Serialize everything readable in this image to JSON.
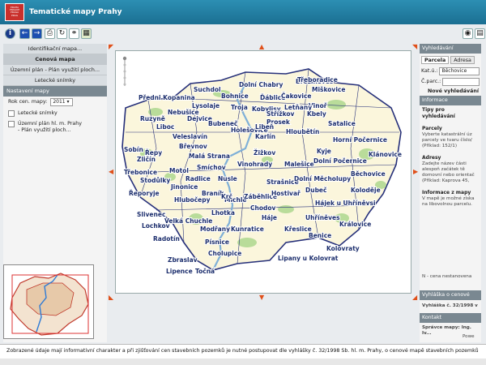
{
  "header": {
    "title": "Tematické mapy Prahy",
    "logo_text": "PRAHA PRAGUE PRAGA PRAG"
  },
  "toolbar": {
    "buttons": [
      "info-icon",
      "back-arrow-icon",
      "forward-arrow-icon",
      "print-icon",
      "reset-icon",
      "link-icon",
      "grid-icon"
    ],
    "right_buttons": [
      "eye-icon",
      "layers-icon"
    ]
  },
  "sidebar": {
    "items": [
      {
        "label": "Identifikační mapa..."
      },
      {
        "label": "Cenová mapa"
      },
      {
        "label": "Územní plán - Plán využití ploch..."
      },
      {
        "label": "Letecké snímky"
      }
    ],
    "section_title": "Nastavení mapy",
    "year_label": "Rok cen. mapy:",
    "year_value": "2011",
    "layer1": "Letecké snímky",
    "layer2_line1": "Územní plán hl. m. Prahy",
    "layer2_line2": "- Plán využití ploch..."
  },
  "map": {
    "districts": [
      "Troja",
      "Dolní Chabry",
      "Ďáblice",
      "Čakovice",
      "Vinoř",
      "Suchdol",
      "Bohnice",
      "Kobylisy",
      "Letňany",
      "Březiněves",
      "Lysolaje",
      "Dejvice",
      "Prosek",
      "Střížkov",
      "Kbely",
      "Satalice",
      "Předni Kopanina",
      "Nebušice",
      "Liboc",
      "Holešovice",
      "Bubeneč",
      "Karlín",
      "Libeň",
      "Hloubětín",
      "Horní Počernice",
      "Ruzyně",
      "Veleslavín",
      "Břevnov",
      "Malá Strana",
      "Žižkov",
      "Kyje",
      "Sobín",
      "Řepy",
      "Zličín",
      "Motol",
      "Smíchov",
      "Vinohrady",
      "Malešice",
      "Dolní Počernice",
      "Klánovice",
      "Třebonice",
      "Stodůlky",
      "Radlice",
      "Nusle",
      "Strašnice",
      "Dolní Měcholupy",
      "Běchovice",
      "Jinonice",
      "Michle",
      "Záběhlice",
      "Hostivař",
      "Dubeč",
      "Koloděje",
      "Řeporyje",
      "Hlubočepy",
      "Braník",
      "Krč",
      "Chodov",
      "Hájek u Uhříněvsi",
      "Slivenec",
      "Velká Chuchle",
      "Lhotka",
      "Háje",
      "Uhříněves",
      "Lochkov",
      "Modřany",
      "Kunratice",
      "Křeslice",
      "Královice",
      "Radotín",
      "Písnice",
      "Benice",
      "Cholupice",
      "Kolovraty",
      "Zbraslav",
      "Lipany u Kolovrat",
      "Lipence",
      "Točná",
      "Třeboradice",
      "Miškovice"
    ]
  },
  "rightpanel": {
    "section_search": "Vyhledávání",
    "tab_parcel": "Parcela",
    "tab_address": "Adresa",
    "ku_label": "Kat.ú.:",
    "ku_value": "Běchovice",
    "parcel_label": "Č.parc.:",
    "new_search": "Nové vyhledávání",
    "section_info": "Informace",
    "tips_title": "Tipy pro vyhledávání",
    "parcel_title": "Parcely",
    "parcel_text": "Vyberte katastrální úz parcely ve tvaru číslo/ (Příklad: 152/1)",
    "address_title": "Adresy",
    "address_text": "Zadejte název části alespoň začátek tě domovní nebo orientač (Příklad: Kaprova 45,",
    "map_info_title": "Informace z mapy",
    "map_info_text": "V mapě je možné získa na libovolnou parcelu.",
    "price_note": "N - cena nestanovena",
    "section_price": "Vyhláška o cenové mapě",
    "price_decree": "Vyhláška č. 32/1998 v",
    "section_contact": "Kontakt",
    "contact_line": "Správce mapy: Ing. Iv...",
    "contact_more": "Powe"
  },
  "footer": {
    "text": "Zobrazené údaje mají informativní charakter a při zjišťování cen stavebních pozemků je nutné postupovat dle vyhlášky č. 32/1998 Sb. hl. m. Prahy, o cenové mapě stavebních pozemků"
  }
}
